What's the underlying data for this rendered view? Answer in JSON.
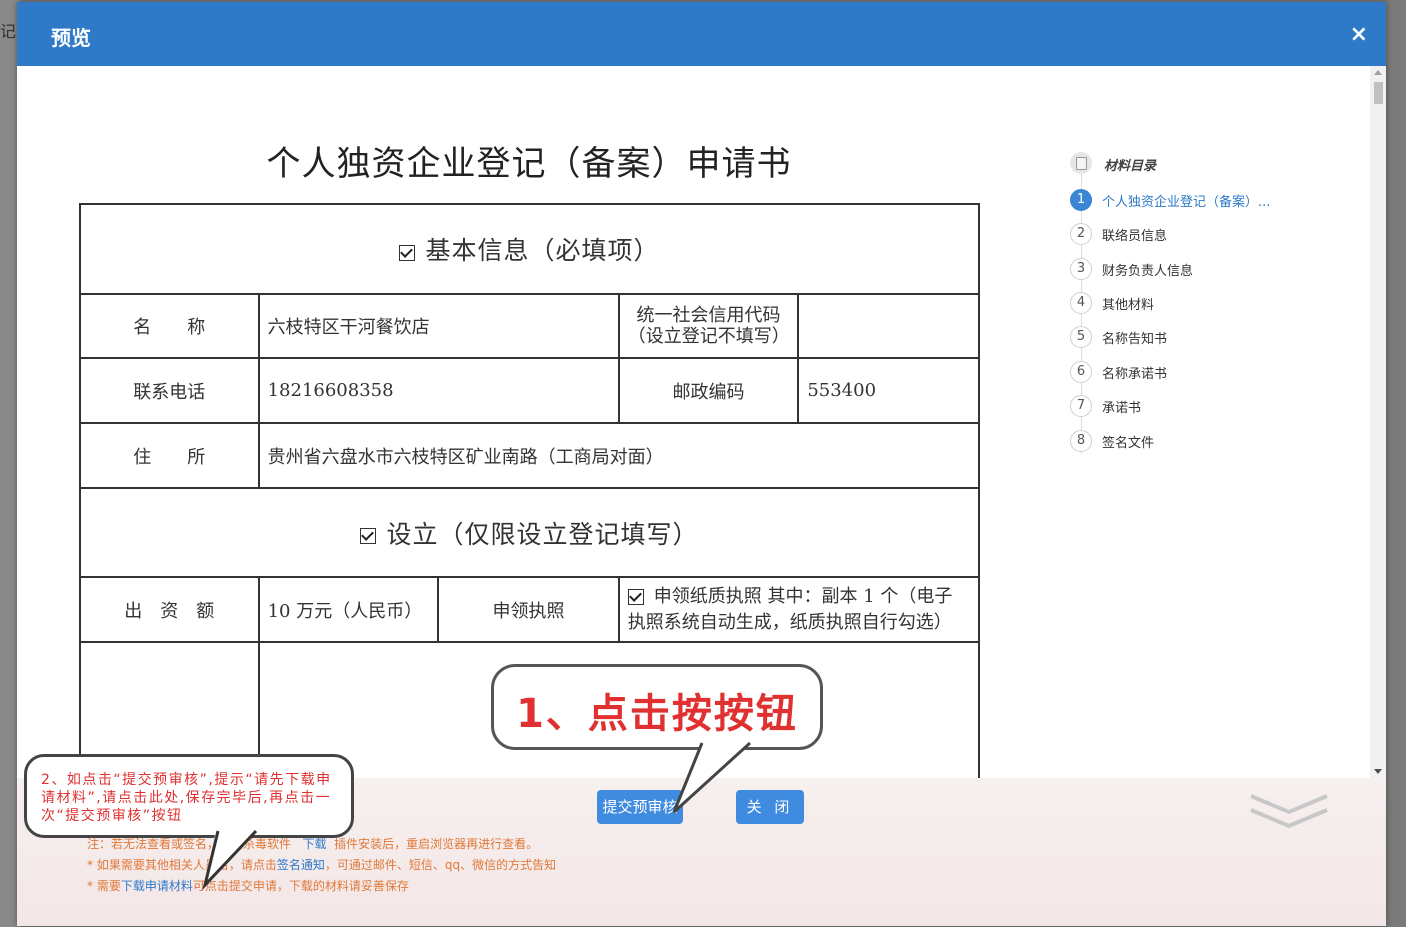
{
  "background": {
    "fragment": "记"
  },
  "modal": {
    "title": "预览",
    "close_icon": "×"
  },
  "document": {
    "title": "个人独资企业登记（备案）申请书",
    "basic_section": "基本信息（必填项）",
    "name_label": "名　　称",
    "name_value": "六枝特区干河餐饮店",
    "credit_code_label_1": "统一社会信用代码",
    "credit_code_label_2": "（设立登记不填写）",
    "credit_code_value": "",
    "phone_label": "联系电话",
    "phone_value": "18216608358",
    "postcode_label": "邮政编码",
    "postcode_value": "553400",
    "address_label": "住　　所",
    "address_value": "贵州省六盘水市六枝特区矿业南路（工商局对面）",
    "setup_section": "设立（仅限设立登记填写）",
    "capital_label": "出　资　额",
    "capital_value": "10 万元（人民币）",
    "license_label": "申领执照",
    "license_value_1": "申领纸质执照 其中：副本 1 个（电子",
    "license_value_2": "执照系统自动生成，纸质执照自行勾选）"
  },
  "toc": {
    "heading": "材料目录",
    "items": [
      {
        "num": "1",
        "label": "个人独资企业登记（备案）..."
      },
      {
        "num": "2",
        "label": "联络员信息"
      },
      {
        "num": "3",
        "label": "财务负责人信息"
      },
      {
        "num": "4",
        "label": "其他材料"
      },
      {
        "num": "5",
        "label": "名称告知书"
      },
      {
        "num": "6",
        "label": "名称承诺书"
      },
      {
        "num": "7",
        "label": "承诺书"
      },
      {
        "num": "8",
        "label": "签名文件"
      }
    ],
    "active_color": "#3a86d4"
  },
  "footer": {
    "submit_button": "提交预审核",
    "close_button": "关 闭",
    "note1_a": "注：若无法查看或签名，",
    "note1_b": "关闭杀毒软件",
    "note1_link": "下载",
    "note1_c": "插件安装后，重启浏览器再进行查看。",
    "note2_a": "* 如果需要其他相关人员",
    "note2_b": "名，请点击",
    "note2_link": "签名通知",
    "note2_c": "，可通过邮件、短信、qq、微信的方式告知",
    "note3_a": "* 需要",
    "note3_link": "下载申请材料",
    "note3_b": "可点击提交申请，下载的材料请妥善保存"
  },
  "annotations": {
    "big_callout": "1、点击按按钮",
    "small_callout": "2、如点击“提交预审核”,提示“请先下载申请材料”,请点击此处,保存完毕后,再点击一次“提交预审核”按钮",
    "color": "#e03030"
  },
  "colors": {
    "header": "#2f79c9",
    "button": "#3f8be0",
    "note": "#e0793a"
  }
}
